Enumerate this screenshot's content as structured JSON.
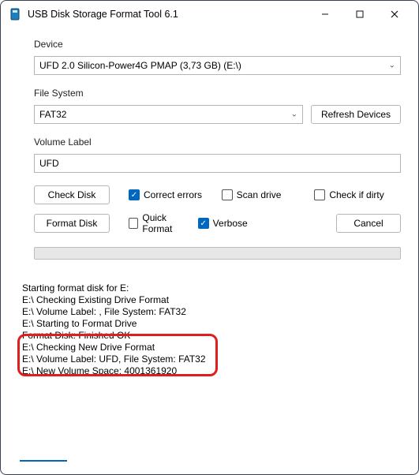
{
  "window": {
    "title": "USB Disk Storage Format Tool 6.1"
  },
  "labels": {
    "device": "Device",
    "file_system": "File System",
    "volume_label": "Volume Label"
  },
  "device": {
    "value": "UFD 2.0  Silicon-Power4G  PMAP (3,73 GB) (E:\\)"
  },
  "file_system": {
    "value": "FAT32"
  },
  "volume_label": {
    "value": "UFD"
  },
  "buttons": {
    "refresh": "Refresh Devices",
    "check_disk": "Check Disk",
    "format_disk": "Format Disk",
    "cancel": "Cancel"
  },
  "checks": {
    "correct_errors": "Correct errors",
    "scan_drive": "Scan drive",
    "check_if_dirty": "Check if dirty",
    "quick_format": "Quick Format",
    "verbose": "Verbose"
  },
  "log": {
    "l0": "Starting format disk for E:",
    "l1": "E:\\ Checking Existing Drive Format",
    "l2": "E:\\ Volume Label: , File System: FAT32",
    "l3": "E:\\ Starting to Format Drive",
    "l4": "Format Disk: Finished OK",
    "l5": "E:\\ Checking New Drive Format",
    "l6": "E:\\ Volume Label: UFD, File System: FAT32",
    "l7": "E:\\ New Volume Space: 4001361920"
  }
}
